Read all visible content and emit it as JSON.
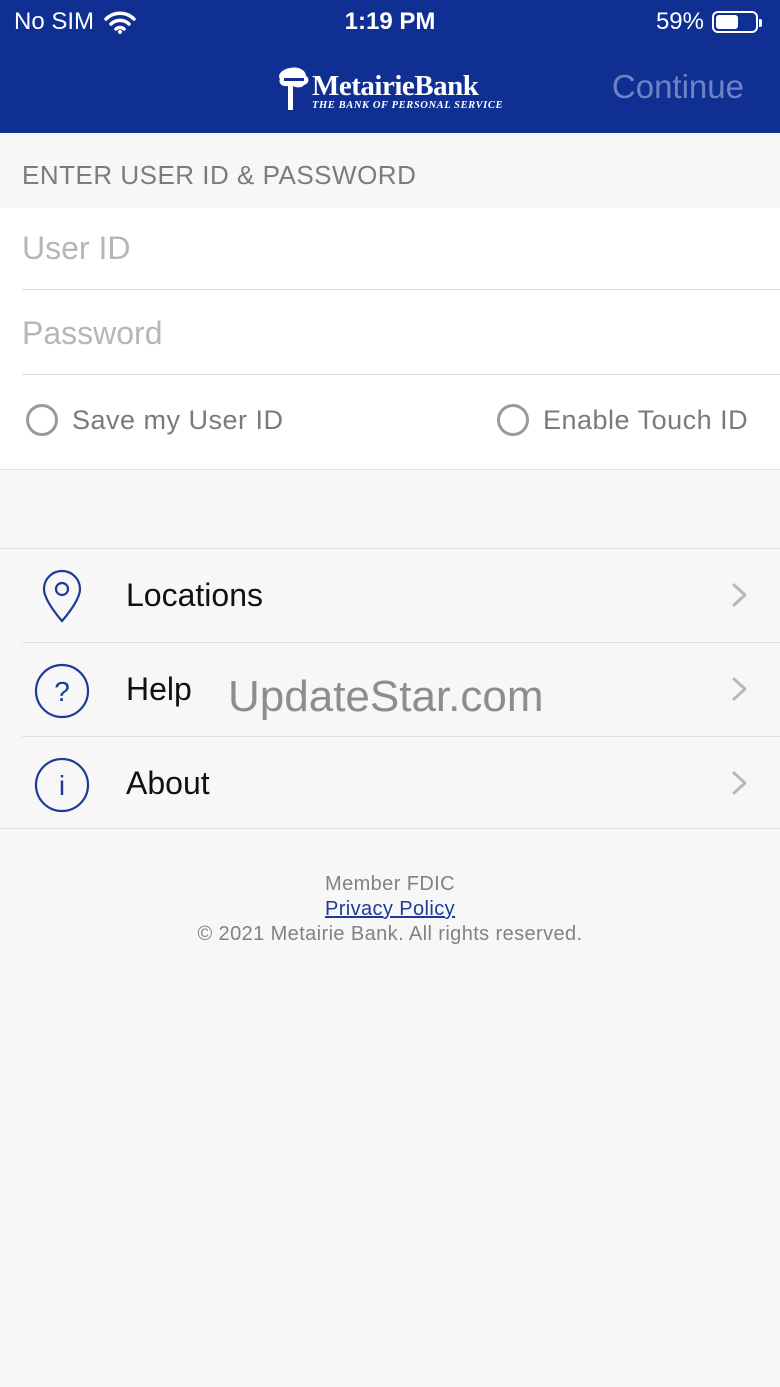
{
  "status_bar": {
    "carrier": "No SIM",
    "time": "1:19 PM",
    "battery_percent": "59%",
    "battery_level": 0.59
  },
  "header": {
    "logo_text": "MetairieBank",
    "logo_tagline": "THE BANK OF PERSONAL SERVICE",
    "continue_label": "Continue"
  },
  "login": {
    "section_title": "ENTER USER ID & PASSWORD",
    "user_id_placeholder": "User ID",
    "password_placeholder": "Password",
    "save_user_id_label": "Save my User ID",
    "enable_touch_id_label": "Enable Touch ID"
  },
  "menu": {
    "items": [
      {
        "label": "Locations",
        "icon": "location-pin-icon"
      },
      {
        "label": "Help",
        "icon": "help-circle-icon"
      },
      {
        "label": "About",
        "icon": "info-circle-icon"
      }
    ]
  },
  "watermark": "UpdateStar.com",
  "footer": {
    "member": "Member FDIC",
    "privacy_policy": "Privacy Policy",
    "copyright": "© 2021 Metairie Bank. All rights reserved."
  },
  "colors": {
    "header_bg": "#102f93",
    "continue_text": "#6f83c4",
    "icon_blue": "#1e3a95",
    "link": "#1b3a9a"
  }
}
